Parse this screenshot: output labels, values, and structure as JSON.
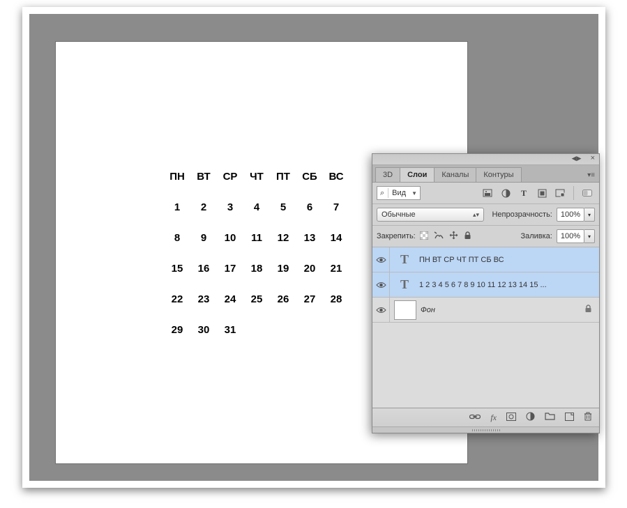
{
  "canvas": {
    "weekday_header": [
      "ПН",
      "ВТ",
      "СР",
      "ЧТ",
      "ПТ",
      "СБ",
      "ВС"
    ],
    "weeks": [
      [
        "1",
        "2",
        "3",
        "4",
        "5",
        "6",
        "7"
      ],
      [
        "8",
        "9",
        "10",
        "11",
        "12",
        "13",
        "14"
      ],
      [
        "15",
        "16",
        "17",
        "18",
        "19",
        "20",
        "21"
      ],
      [
        "22",
        "23",
        "24",
        "25",
        "26",
        "27",
        "28"
      ],
      [
        "29",
        "30",
        "31",
        "",
        "",
        "",
        ""
      ]
    ]
  },
  "panel": {
    "tabs": {
      "t0": "3D",
      "t1": "Слои",
      "t2": "Каналы",
      "t3": "Контуры"
    },
    "filter": {
      "label": "Вид"
    },
    "blend_mode": "Обычные",
    "opacity_label": "Непрозрачность:",
    "opacity_value": "100%",
    "lock_label": "Закрепить:",
    "fill_label": "Заливка:",
    "fill_value": "100%",
    "layers": [
      {
        "selected": true,
        "type": "text",
        "name": "ПН ВТ СР ЧТ ПТ СБ ВС",
        "locked": false
      },
      {
        "selected": true,
        "type": "text",
        "name": "1 2 3 4 5 6 7 8 9 10 11 12 13 14 15 ...",
        "locked": false
      },
      {
        "selected": false,
        "type": "bg",
        "name": "Фон",
        "locked": true
      }
    ],
    "footer_fx": "fx"
  }
}
